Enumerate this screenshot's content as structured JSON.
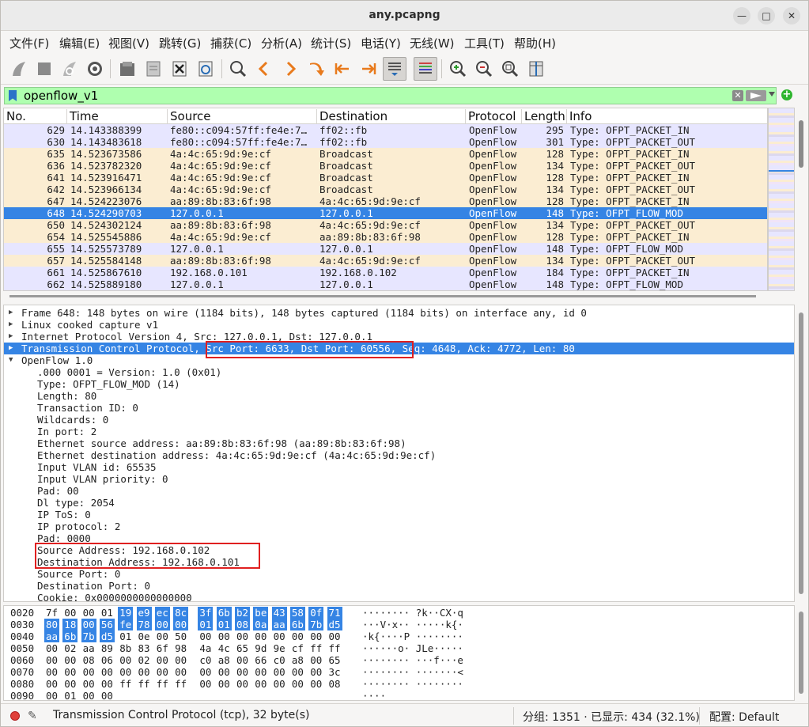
{
  "window": {
    "title": "any.pcapng"
  },
  "menu": [
    "文件(F)",
    "编辑(E)",
    "视图(V)",
    "跳转(G)",
    "捕获(C)",
    "分析(A)",
    "统计(S)",
    "电话(Y)",
    "无线(W)",
    "工具(T)",
    "帮助(H)"
  ],
  "toolbar": [
    "start-capture-icon",
    "stop-capture-icon",
    "restart-capture-icon",
    "capture-options-icon",
    "open-file-icon",
    "save-file-icon",
    "close-file-icon",
    "reload-file-icon",
    "find-packet-icon",
    "previous-packet-icon",
    "next-packet-icon",
    "go-to-packet-icon",
    "first-packet-icon",
    "last-packet-icon",
    "autoscroll-icon",
    "colorize-icon",
    "zoom-in-icon",
    "zoom-out-icon",
    "normal-size-icon",
    "resize-columns-icon"
  ],
  "filter": {
    "value": "openflow_v1"
  },
  "packet_list": {
    "columns": [
      "No.",
      "Time",
      "Source",
      "Destination",
      "Protocol",
      "Length",
      "Info"
    ],
    "rows": [
      {
        "no": "629",
        "time": "14.143388399",
        "src": "fe80::c094:57ff:fe4e:7…",
        "dst": "ff02::fb",
        "proto": "OpenFlow",
        "len": "295",
        "info": "Type: OFPT_PACKET_IN",
        "color": "pkt-in"
      },
      {
        "no": "630",
        "time": "14.143483618",
        "src": "fe80::c094:57ff:fe4e:7…",
        "dst": "ff02::fb",
        "proto": "OpenFlow",
        "len": "301",
        "info": "Type: OFPT_PACKET_OUT",
        "color": "pkt-in"
      },
      {
        "no": "635",
        "time": "14.523673586",
        "src": "4a:4c:65:9d:9e:cf",
        "dst": "Broadcast",
        "proto": "OpenFlow",
        "len": "128",
        "info": "Type: OFPT_PACKET_IN",
        "color": "bcast"
      },
      {
        "no": "636",
        "time": "14.523782320",
        "src": "4a:4c:65:9d:9e:cf",
        "dst": "Broadcast",
        "proto": "OpenFlow",
        "len": "134",
        "info": "Type: OFPT_PACKET_OUT",
        "color": "bcast"
      },
      {
        "no": "641",
        "time": "14.523916471",
        "src": "4a:4c:65:9d:9e:cf",
        "dst": "Broadcast",
        "proto": "OpenFlow",
        "len": "128",
        "info": "Type: OFPT_PACKET_IN",
        "color": "bcast"
      },
      {
        "no": "642",
        "time": "14.523966134",
        "src": "4a:4c:65:9d:9e:cf",
        "dst": "Broadcast",
        "proto": "OpenFlow",
        "len": "134",
        "info": "Type: OFPT_PACKET_OUT",
        "color": "bcast"
      },
      {
        "no": "647",
        "time": "14.524223076",
        "src": "aa:89:8b:83:6f:98",
        "dst": "4a:4c:65:9d:9e:cf",
        "proto": "OpenFlow",
        "len": "128",
        "info": "Type: OFPT_PACKET_IN",
        "color": "bcast"
      },
      {
        "no": "648",
        "time": "14.524290703",
        "src": "127.0.0.1",
        "dst": "127.0.0.1",
        "proto": "OpenFlow",
        "len": "148",
        "info": "Type: OFPT_FLOW_MOD",
        "color": "sel"
      },
      {
        "no": "650",
        "time": "14.524302124",
        "src": "aa:89:8b:83:6f:98",
        "dst": "4a:4c:65:9d:9e:cf",
        "proto": "OpenFlow",
        "len": "134",
        "info": "Type: OFPT_PACKET_OUT",
        "color": "bcast"
      },
      {
        "no": "654",
        "time": "14.525545886",
        "src": "4a:4c:65:9d:9e:cf",
        "dst": "aa:89:8b:83:6f:98",
        "proto": "OpenFlow",
        "len": "128",
        "info": "Type: OFPT_PACKET_IN",
        "color": "bcast"
      },
      {
        "no": "655",
        "time": "14.525573789",
        "src": "127.0.0.1",
        "dst": "127.0.0.1",
        "proto": "OpenFlow",
        "len": "148",
        "info": "Type: OFPT_FLOW_MOD",
        "color": "pkt-in"
      },
      {
        "no": "657",
        "time": "14.525584148",
        "src": "aa:89:8b:83:6f:98",
        "dst": "4a:4c:65:9d:9e:cf",
        "proto": "OpenFlow",
        "len": "134",
        "info": "Type: OFPT_PACKET_OUT",
        "color": "bcast"
      },
      {
        "no": "661",
        "time": "14.525867610",
        "src": "192.168.0.101",
        "dst": "192.168.0.102",
        "proto": "OpenFlow",
        "len": "184",
        "info": "Type: OFPT_PACKET_IN",
        "color": "pkt-in"
      },
      {
        "no": "662",
        "time": "14.525889180",
        "src": "127.0.0.1",
        "dst": "127.0.0.1",
        "proto": "OpenFlow",
        "len": "148",
        "info": "Type: OFPT_FLOW_MOD",
        "color": "pkt-in"
      }
    ]
  },
  "details": [
    {
      "text": "Frame 648: 148 bytes on wire (1184 bits), 148 bytes captured (1184 bits) on interface any, id 0",
      "level": 0,
      "arrow": "▶"
    },
    {
      "text": "Linux cooked capture v1",
      "level": 0,
      "arrow": "▶"
    },
    {
      "text": "Internet Protocol Version 4, Src: 127.0.0.1, Dst: 127.0.0.1",
      "level": 0,
      "arrow": "▶"
    },
    {
      "text": "Transmission Control Protocol, Src Port: 6633, Dst Port: 60556, Seq: 4648, Ack: 4772, Len: 80",
      "level": 0,
      "arrow": "▶",
      "selected": true
    },
    {
      "text": "OpenFlow 1.0",
      "level": 0,
      "arrow": "▼"
    },
    {
      "text": ".000 0001 = Version: 1.0 (0x01)",
      "level": 1
    },
    {
      "text": "Type: OFPT_FLOW_MOD (14)",
      "level": 1
    },
    {
      "text": "Length: 80",
      "level": 1
    },
    {
      "text": "Transaction ID: 0",
      "level": 1
    },
    {
      "text": "Wildcards: 0",
      "level": 1
    },
    {
      "text": "In port: 2",
      "level": 1
    },
    {
      "text": "Ethernet source address: aa:89:8b:83:6f:98 (aa:89:8b:83:6f:98)",
      "level": 1
    },
    {
      "text": "Ethernet destination address: 4a:4c:65:9d:9e:cf (4a:4c:65:9d:9e:cf)",
      "level": 1
    },
    {
      "text": "Input VLAN id: 65535",
      "level": 1
    },
    {
      "text": "Input VLAN priority: 0",
      "level": 1
    },
    {
      "text": "Pad: 00",
      "level": 1
    },
    {
      "text": "Dl type: 2054",
      "level": 1
    },
    {
      "text": "IP ToS: 0",
      "level": 1
    },
    {
      "text": "IP protocol: 2",
      "level": 1
    },
    {
      "text": "Pad: 0000",
      "level": 1
    },
    {
      "text": "Source Address: 192.168.0.102",
      "level": 1
    },
    {
      "text": "Destination Address: 192.168.0.101",
      "level": 1
    },
    {
      "text": "Source Port: 0",
      "level": 1
    },
    {
      "text": "Destination Port: 0",
      "level": 1
    },
    {
      "text": "Cookie: 0x0000000000000000",
      "level": 1
    }
  ],
  "hex": [
    {
      "offset": "0020",
      "bytes": [
        "7f",
        "00",
        "00",
        "01",
        "19",
        "e9",
        "ec",
        "8c",
        "3f",
        "6b",
        "b2",
        "be",
        "43",
        "58",
        "0f",
        "71"
      ],
      "ascii": "········ ?k··CX·q",
      "hl_from": 4
    },
    {
      "offset": "0030",
      "bytes": [
        "80",
        "18",
        "00",
        "56",
        "fe",
        "78",
        "00",
        "00",
        "01",
        "01",
        "08",
        "0a",
        "aa",
        "6b",
        "7b",
        "d5"
      ],
      "ascii": "···V·x·· ·····k{·",
      "hl_from": 0,
      "hl_to": 16
    },
    {
      "offset": "0040",
      "bytes": [
        "aa",
        "6b",
        "7b",
        "d5",
        "01",
        "0e",
        "00",
        "50",
        "00",
        "00",
        "00",
        "00",
        "00",
        "00",
        "00",
        "00"
      ],
      "ascii": "·k{····P ········",
      "hl_to": 4
    },
    {
      "offset": "0050",
      "bytes": [
        "00",
        "02",
        "aa",
        "89",
        "8b",
        "83",
        "6f",
        "98",
        "4a",
        "4c",
        "65",
        "9d",
        "9e",
        "cf",
        "ff",
        "ff"
      ],
      "ascii": "······o· JLe·····"
    },
    {
      "offset": "0060",
      "bytes": [
        "00",
        "00",
        "08",
        "06",
        "00",
        "02",
        "00",
        "00",
        "c0",
        "a8",
        "00",
        "66",
        "c0",
        "a8",
        "00",
        "65"
      ],
      "ascii": "········ ···f···e"
    },
    {
      "offset": "0070",
      "bytes": [
        "00",
        "00",
        "00",
        "00",
        "00",
        "00",
        "00",
        "00",
        "00",
        "00",
        "00",
        "00",
        "00",
        "00",
        "00",
        "3c"
      ],
      "ascii": "········ ·······<"
    },
    {
      "offset": "0080",
      "bytes": [
        "00",
        "00",
        "00",
        "00",
        "ff",
        "ff",
        "ff",
        "ff",
        "00",
        "00",
        "00",
        "00",
        "00",
        "00",
        "00",
        "08"
      ],
      "ascii": "········ ········"
    },
    {
      "offset": "0090",
      "bytes": [
        "00",
        "01",
        "00",
        "00"
      ],
      "ascii": "····"
    }
  ],
  "status": {
    "field": "Transmission Control Protocol (tcp), 32 byte(s)",
    "packets": "分组: 1351 · 已显示: 434 (32.1%)",
    "profile": "配置: Default"
  }
}
